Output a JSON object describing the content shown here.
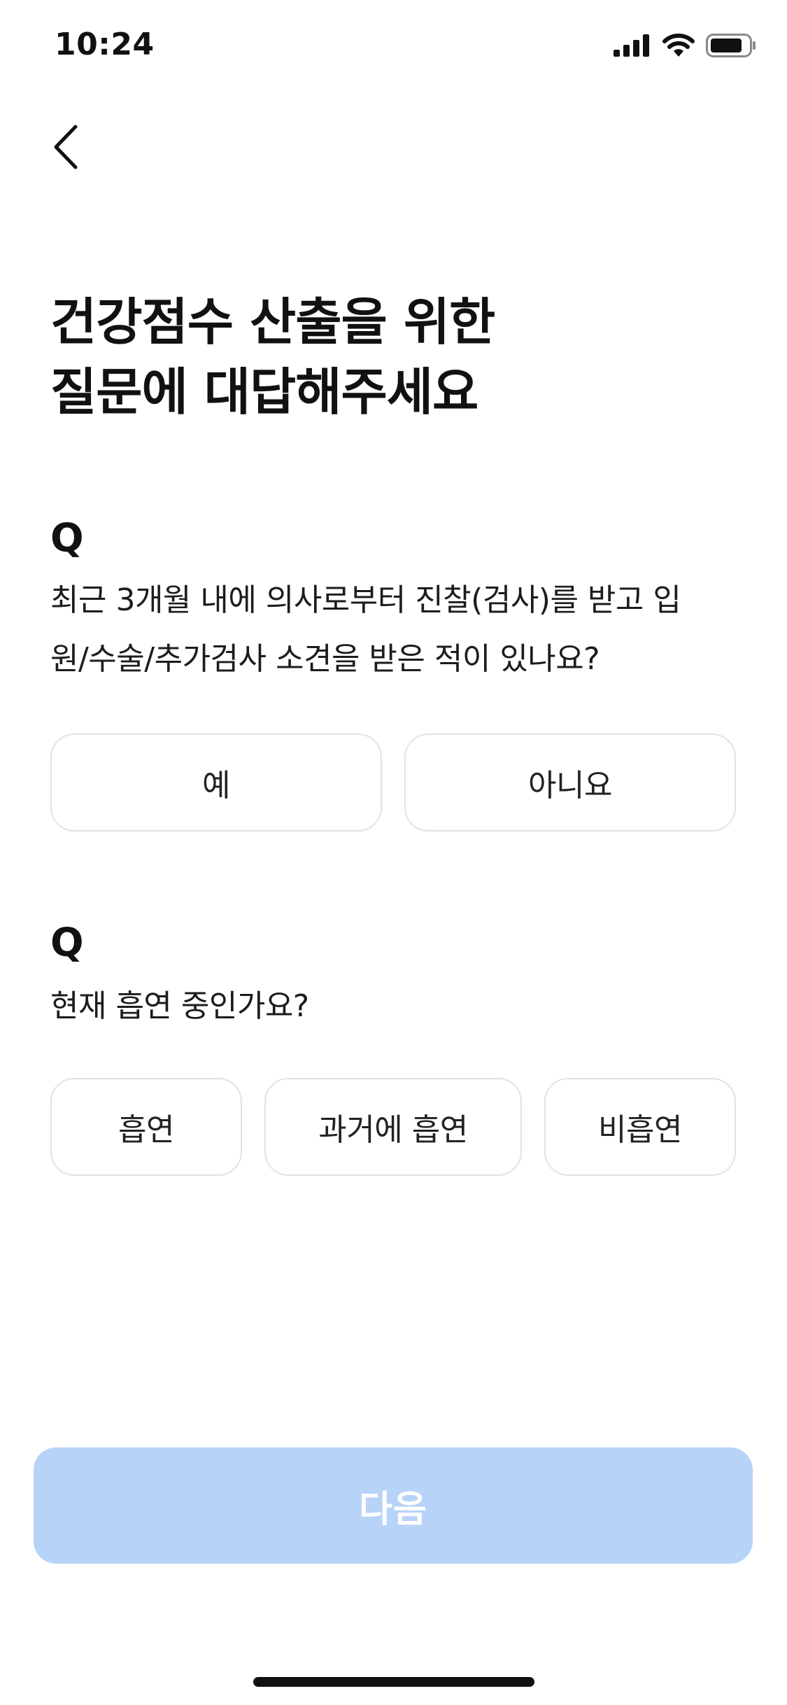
{
  "status_bar": {
    "time": "10:24",
    "icons": [
      "cellular-signal-icon",
      "wifi-icon",
      "battery-icon"
    ]
  },
  "nav": {
    "back_icon": "chevron-left-icon"
  },
  "title": {
    "line1": "건강점수 산출을 위한",
    "line2": "질문에 대답해주세요"
  },
  "questions": [
    {
      "marker": "Q",
      "text_line1": "최근 3개월 내에 의사로부터 진찰(검사)를 받고 입",
      "text_line2": "원/수술/추가검사 소견을 받은 적이 있나요?",
      "options": [
        "예",
        "아니요"
      ]
    },
    {
      "marker": "Q",
      "text_line1": "현재 흡연 중인가요?",
      "options": [
        "흡연",
        "과거에 흡연",
        "비흡연"
      ]
    }
  ],
  "next_button": {
    "label": "다음",
    "enabled": false,
    "color": "#b8d3f8"
  }
}
